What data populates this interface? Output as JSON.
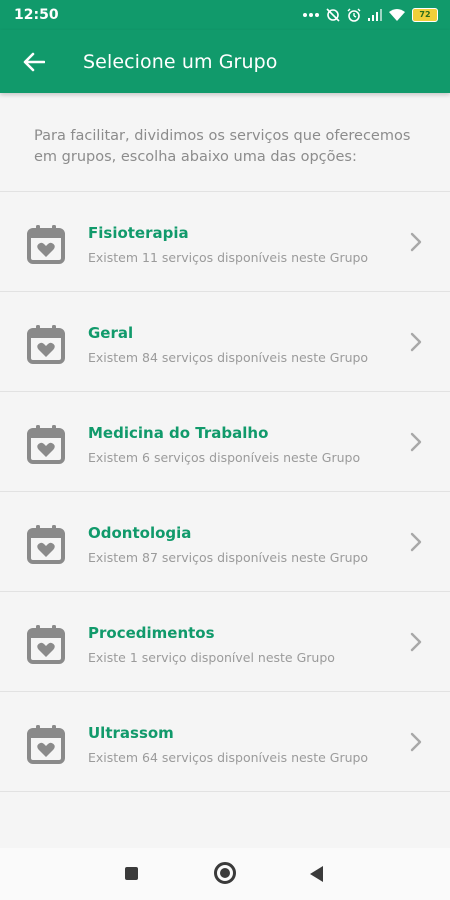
{
  "status_bar": {
    "time": "12:50",
    "battery": "72",
    "icons": [
      "dots-icon",
      "alarm-off-icon",
      "alarm-icon",
      "signal-icon",
      "wifi-icon",
      "battery-icon"
    ]
  },
  "app_bar": {
    "title": "Selecione um Grupo",
    "back_icon": "arrow-left-icon",
    "background": "#119a6b"
  },
  "intro": "Para facilitar, dividimos os serviços que oferecemos em grupos, escolha abaixo uma das opções:",
  "groups": [
    {
      "title": "Fisioterapia",
      "subtitle": "Existem 11 serviços disponíveis neste Grupo"
    },
    {
      "title": "Geral",
      "subtitle": "Existem 84 serviços disponíveis neste Grupo"
    },
    {
      "title": "Medicina do Trabalho",
      "subtitle": "Existem 6 serviços disponíveis neste Grupo"
    },
    {
      "title": "Odontologia",
      "subtitle": "Existem 87 serviços disponíveis neste Grupo"
    },
    {
      "title": "Procedimentos",
      "subtitle": "Existe 1 serviço disponível neste Grupo"
    },
    {
      "title": "Ultrassom",
      "subtitle": "Existem 64 serviços disponíveis neste Grupo"
    }
  ],
  "icons": {
    "group_icon": "calendar-heart-icon",
    "chevron": "chevron-right-icon"
  },
  "colors": {
    "accent": "#119a6b",
    "subtitle": "#9b9b9b",
    "icon": "#8a8a8a"
  }
}
